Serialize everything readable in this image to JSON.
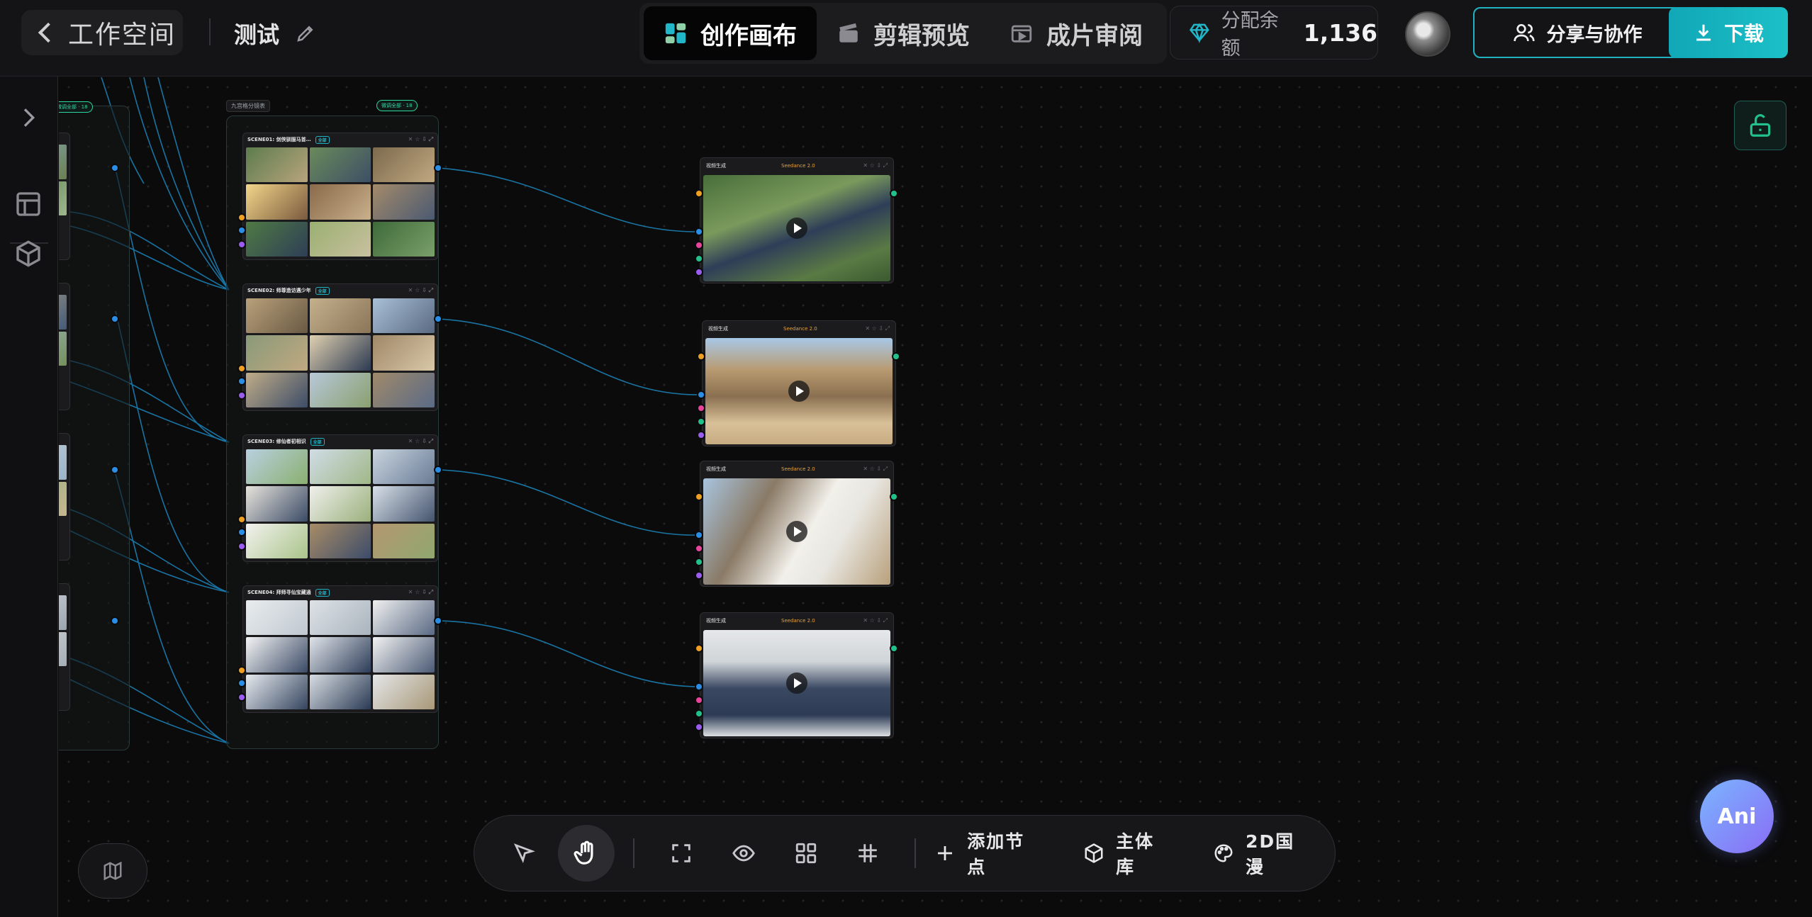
{
  "header": {
    "back_label": "工作空间",
    "project_name": "测试",
    "tabs": [
      {
        "label": "创作画布",
        "active": true
      },
      {
        "label": "剪辑预览",
        "active": false
      },
      {
        "label": "成片审阅",
        "active": false
      }
    ],
    "balance_label": "分配余额",
    "balance_value": "1,136",
    "share_label": "分享与协作",
    "download_label": "下载"
  },
  "canvas": {
    "group_title": "九宫格分镜表",
    "group_badge": "微调全部 · 18",
    "left_group_badge": "微调全部 · 18",
    "storyboards": [
      {
        "title": "SCENE01: 剑侠驯服马首…",
        "tag": "全部"
      },
      {
        "title": "SCENE02: 师尊造访遇少年",
        "tag": "全部"
      },
      {
        "title": "SCENE03: 修仙者初相识",
        "tag": "全部"
      },
      {
        "title": "SCENE04: 拜师寻仙宝藏通",
        "tag": "全部"
      }
    ],
    "videos": [
      {
        "title": "视频生成",
        "model": "Seedance 2.0"
      },
      {
        "title": "视频生成",
        "model": "Seedance 2.0"
      },
      {
        "title": "视频生成",
        "model": "Seedance 2.0"
      },
      {
        "title": "视频生成",
        "model": "Seedance 2.0"
      }
    ]
  },
  "toolbar": {
    "add_node_label": "添加节点",
    "library_label": "主体库",
    "style_label": "2D国漫"
  },
  "assistant_label": "Ani",
  "colors": {
    "accent": "#1fb3c2",
    "port_blue": "#2a8ee6",
    "port_orange": "#f0a020",
    "port_purple": "#9b5cf0",
    "model_orange": "#e7a33c"
  }
}
